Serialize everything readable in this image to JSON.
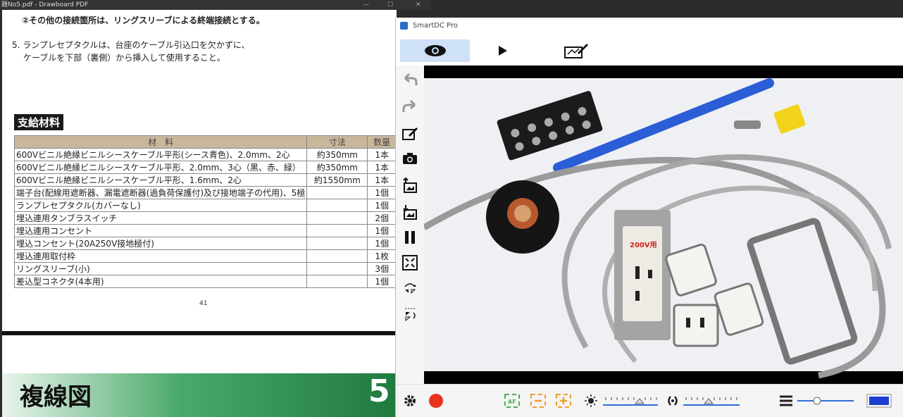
{
  "pdf": {
    "window_title": "題No5.pdf - Drawboard PDF",
    "line_connection": "②その他の接続箇所は、リングスリーブによる終端接続とする。",
    "item5_line1": "5. ランプレセプタクルは、台座のケーブル引込口を欠かずに、",
    "item5_line2": "ケーブルを下部（裏側）から挿入して使用すること。",
    "supply_heading": "支給材料",
    "table_headers": [
      "材　料",
      "寸法",
      "数量"
    ],
    "rows": [
      {
        "material": "600Vビニル絶縁ビニルシースケーブル平形(シース青色)、2.0mm、2心",
        "dim": "約350mm",
        "qty": "1本"
      },
      {
        "material": "600Vビニル絶縁ビニルシースケーブル平形、2.0mm、3心（黒、赤、緑）",
        "dim": "約350mm",
        "qty": "1本"
      },
      {
        "material": "600Vビニル絶縁ビニルシースケーブル平形、1.6mm、2心",
        "dim": "約1550mm",
        "qty": "1本"
      },
      {
        "material": "端子台(配線用遮断器、漏電遮断器(過負荷保護付)及び接地端子の代用)、5極",
        "dim": "",
        "qty": "1個"
      },
      {
        "material": "ランプレセプタクル(カバーなし)",
        "dim": "",
        "qty": "1個"
      },
      {
        "material": "埋込連用タンブラスイッチ",
        "dim": "",
        "qty": "2個"
      },
      {
        "material": "埋込連用コンセント",
        "dim": "",
        "qty": "1個"
      },
      {
        "material": "埋込コンセント(20A250V接地極付)",
        "dim": "",
        "qty": "1個"
      },
      {
        "material": "埋込連用取付枠",
        "dim": "",
        "qty": "1枚"
      },
      {
        "material": "リングスリーブ(小)",
        "dim": "",
        "qty": "3個"
      },
      {
        "material": "差込型コネクタ(4本用)",
        "dim": "",
        "qty": "1個"
      }
    ],
    "page_number": "41",
    "next_title": "複線図",
    "section_number": "5"
  },
  "smartdc": {
    "window_title": "SmartDC Pro",
    "outlet_label": "200V用",
    "colors": {
      "accent": "#cfe1f7",
      "record": "#e8321e",
      "af_green": "#4caf50",
      "zoom_orange": "#f0a030",
      "slider_blue": "#2c6fd6"
    }
  }
}
